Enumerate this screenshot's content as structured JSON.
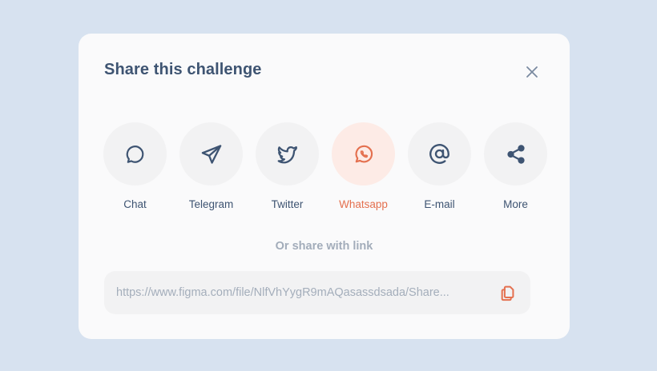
{
  "modal": {
    "title": "Share this challenge",
    "close_icon": "close-icon"
  },
  "share_options": [
    {
      "label": "Chat",
      "icon": "chat-bubble-icon",
      "active": false
    },
    {
      "label": "Telegram",
      "icon": "telegram-icon",
      "active": false
    },
    {
      "label": "Twitter",
      "icon": "twitter-icon",
      "active": false
    },
    {
      "label": "Whatsapp",
      "icon": "whatsapp-icon",
      "active": true
    },
    {
      "label": "E-mail",
      "icon": "at-sign-icon",
      "active": false
    },
    {
      "label": "More",
      "icon": "share-nodes-icon",
      "active": false
    }
  ],
  "link_section": {
    "heading": "Or share with link",
    "url": "https://www.figma.com/file/NlfVhYygR9mAQasassdsada/Share...",
    "copy_icon": "copy-icon"
  },
  "colors": {
    "background": "#d7e2f0",
    "modal": "#fafafb",
    "text": "#3e5472",
    "muted": "#a2acba",
    "accent": "#e4704f",
    "accent_bg": "#fdebe6",
    "circle_bg": "#f2f2f3"
  }
}
